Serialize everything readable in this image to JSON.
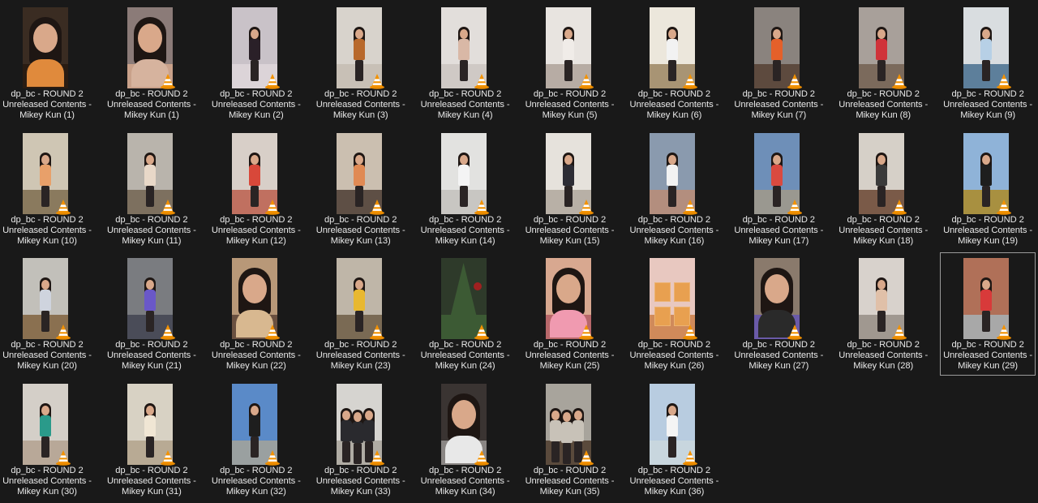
{
  "grid": {
    "columns": 10,
    "selected_item": 30,
    "items": [
      {
        "line1": "dp_bc - ROUND 2",
        "line2": "Unreleased Contents -",
        "line3": "Mikey Kun (1)",
        "vlc": false,
        "scene": "closeup",
        "bg": "#3a2c22",
        "floor": "#2a1c12",
        "top": "#e08a3c"
      },
      {
        "line1": "dp_bc - ROUND 2",
        "line2": "Unreleased Contents -",
        "line3": "Mikey Kun (1)",
        "vlc": true,
        "scene": "closeup",
        "bg": "#8b7b78",
        "floor": "#c9a18a",
        "top": "#d6b39e"
      },
      {
        "line1": "dp_bc - ROUND 2",
        "line2": "Unreleased Contents -",
        "line3": "Mikey Kun (2)",
        "vlc": true,
        "scene": "full",
        "bg": "#c9c2c8",
        "floor": "#dcd4d8",
        "top": "#2a2028"
      },
      {
        "line1": "dp_bc - ROUND 2",
        "line2": "Unreleased Contents -",
        "line3": "Mikey Kun (3)",
        "vlc": true,
        "scene": "full",
        "bg": "#d8d3cc",
        "floor": "#c8c0b6",
        "top": "#b8692c"
      },
      {
        "line1": "dp_bc - ROUND 2",
        "line2": "Unreleased Contents -",
        "line3": "Mikey Kun (4)",
        "vlc": true,
        "scene": "full",
        "bg": "#e2dedb",
        "floor": "#cfc9c5",
        "top": "#d9b8a6"
      },
      {
        "line1": "dp_bc - ROUND 2",
        "line2": "Unreleased Contents -",
        "line3": "Mikey Kun (5)",
        "vlc": true,
        "scene": "full",
        "bg": "#e8e4e0",
        "floor": "#b7aca4",
        "top": "#f0ece8"
      },
      {
        "line1": "dp_bc - ROUND 2",
        "line2": "Unreleased Contents -",
        "line3": "Mikey Kun (6)",
        "vlc": true,
        "scene": "full",
        "bg": "#ece7dc",
        "floor": "#a89474",
        "top": "#f2f2f2"
      },
      {
        "line1": "dp_bc - ROUND 2",
        "line2": "Unreleased Contents -",
        "line3": "Mikey Kun (7)",
        "vlc": true,
        "scene": "full",
        "bg": "#8a837e",
        "floor": "#5d4a3e",
        "top": "#e4602a"
      },
      {
        "line1": "dp_bc - ROUND 2",
        "line2": "Unreleased Contents -",
        "line3": "Mikey Kun (8)",
        "vlc": true,
        "scene": "full",
        "bg": "#a8a09a",
        "floor": "#7b6a5c",
        "top": "#d0333a"
      },
      {
        "line1": "dp_bc - ROUND 2",
        "line2": "Unreleased Contents -",
        "line3": "Mikey Kun (9)",
        "vlc": true,
        "scene": "full",
        "bg": "#d9dde0",
        "floor": "#5d7f9b",
        "top": "#b7d0e6"
      },
      {
        "line1": "dp_bc - ROUND 2",
        "line2": "Unreleased Contents -",
        "line3": "Mikey Kun (10)",
        "vlc": true,
        "scene": "full",
        "bg": "#cfc6b4",
        "floor": "#8a7a5e",
        "top": "#e8a06a"
      },
      {
        "line1": "dp_bc - ROUND 2",
        "line2": "Unreleased Contents -",
        "line3": "Mikey Kun (11)",
        "vlc": true,
        "scene": "full",
        "bg": "#b9b4ac",
        "floor": "#7d705f",
        "top": "#e8d8c8"
      },
      {
        "line1": "dp_bc - ROUND 2",
        "line2": "Unreleased Contents -",
        "line3": "Mikey Kun (12)",
        "vlc": true,
        "scene": "full",
        "bg": "#d8cfc8",
        "floor": "#c07060",
        "top": "#d8483a"
      },
      {
        "line1": "dp_bc - ROUND 2",
        "line2": "Unreleased Contents -",
        "line3": "Mikey Kun (13)",
        "vlc": true,
        "scene": "full",
        "bg": "#cbbfb0",
        "floor": "#5e4f45",
        "top": "#e08a54"
      },
      {
        "line1": "dp_bc - ROUND 2",
        "line2": "Unreleased Contents -",
        "line3": "Mikey Kun (14)",
        "vlc": true,
        "scene": "full",
        "bg": "#e2e2e0",
        "floor": "#c8c6c2",
        "top": "#f4f4f4"
      },
      {
        "line1": "dp_bc - ROUND 2",
        "line2": "Unreleased Contents -",
        "line3": "Mikey Kun (15)",
        "vlc": true,
        "scene": "full",
        "bg": "#e6e2dc",
        "floor": "#b8b0a6",
        "top": "#2c2c34"
      },
      {
        "line1": "dp_bc - ROUND 2",
        "line2": "Unreleased Contents -",
        "line3": "Mikey Kun (16)",
        "vlc": true,
        "scene": "full",
        "bg": "#8a9aae",
        "floor": "#b38e7e",
        "top": "#f2f2f2"
      },
      {
        "line1": "dp_bc - ROUND 2",
        "line2": "Unreleased Contents -",
        "line3": "Mikey Kun (17)",
        "vlc": true,
        "scene": "full",
        "bg": "#6e8fb8",
        "floor": "#9a9890",
        "top": "#d94a40"
      },
      {
        "line1": "dp_bc - ROUND 2",
        "line2": "Unreleased Contents -",
        "line3": "Mikey Kun (18)",
        "vlc": true,
        "scene": "full",
        "bg": "#d6d0c8",
        "floor": "#7a5a48",
        "top": "#3a3a3a"
      },
      {
        "line1": "dp_bc - ROUND 2",
        "line2": "Unreleased Contents -",
        "line3": "Mikey Kun (19)",
        "vlc": true,
        "scene": "full",
        "bg": "#8fb3d8",
        "floor": "#a89040",
        "top": "#1e1e1e"
      },
      {
        "line1": "dp_bc - ROUND 2",
        "line2": "Unreleased Contents -",
        "line3": "Mikey Kun (20)",
        "vlc": true,
        "scene": "full",
        "bg": "#c2c0ba",
        "floor": "#8a7050",
        "top": "#cfd4de"
      },
      {
        "line1": "dp_bc - ROUND 2",
        "line2": "Unreleased Contents -",
        "line3": "Mikey Kun (21)",
        "vlc": true,
        "scene": "full",
        "bg": "#7a7c80",
        "floor": "#4a4c58",
        "top": "#6a58c8"
      },
      {
        "line1": "dp_bc - ROUND 2",
        "line2": "Unreleased Contents -",
        "line3": "Mikey Kun (22)",
        "vlc": true,
        "scene": "closeup",
        "bg": "#b89878",
        "floor": "#6a5040",
        "top": "#d8b890"
      },
      {
        "line1": "dp_bc - ROUND 2",
        "line2": "Unreleased Contents -",
        "line3": "Mikey Kun (23)",
        "vlc": true,
        "scene": "full",
        "bg": "#bfb6a8",
        "floor": "#7a6a54",
        "top": "#e8b830"
      },
      {
        "line1": "dp_bc - ROUND 2",
        "line2": "Unreleased Contents -",
        "line3": "Mikey Kun (24)",
        "vlc": true,
        "scene": "tree",
        "bg": "#2e3a2a",
        "floor": "#3c5a34",
        "top": "#7a9a5a"
      },
      {
        "line1": "dp_bc - ROUND 2",
        "line2": "Unreleased Contents -",
        "line3": "Mikey Kun (25)",
        "vlc": true,
        "scene": "closeup",
        "bg": "#d8a890",
        "floor": "#b8686a",
        "top": "#f09ab0"
      },
      {
        "line1": "dp_bc - ROUND 2",
        "line2": "Unreleased Contents -",
        "line3": "Mikey Kun (26)",
        "vlc": true,
        "scene": "shelf",
        "bg": "#e8c8c0",
        "floor": "#d08a5a",
        "top": "#e8a050"
      },
      {
        "line1": "dp_bc - ROUND 2",
        "line2": "Unreleased Contents -",
        "line3": "Mikey Kun (27)",
        "vlc": true,
        "scene": "closeup",
        "bg": "#8a7a6c",
        "floor": "#6a5aa8",
        "top": "#2a2a2a"
      },
      {
        "line1": "dp_bc - ROUND 2",
        "line2": "Unreleased Contents -",
        "line3": "Mikey Kun (28)",
        "vlc": true,
        "scene": "full",
        "bg": "#d8d2cc",
        "floor": "#a09890",
        "top": "#e0c0a8"
      },
      {
        "line1": "dp_bc - ROUND 2",
        "line2": "Unreleased Contents -",
        "line3": "Mikey Kun (29)",
        "vlc": true,
        "scene": "full",
        "bg": "#b07058",
        "floor": "#a8a8a8",
        "top": "#d83a3a"
      },
      {
        "line1": "dp_bc - ROUND 2",
        "line2": "Unreleased Contents -",
        "line3": "Mikey Kun (30)",
        "vlc": true,
        "scene": "full",
        "bg": "#d4cfc8",
        "floor": "#b8a898",
        "top": "#2a9a8a"
      },
      {
        "line1": "dp_bc - ROUND 2",
        "line2": "Unreleased Contents -",
        "line3": "Mikey Kun (31)",
        "vlc": true,
        "scene": "full",
        "bg": "#d8d2c4",
        "floor": "#b8aa94",
        "top": "#f0e6d4"
      },
      {
        "line1": "dp_bc - ROUND 2",
        "line2": "Unreleased Contents -",
        "line3": "Mikey Kun (32)",
        "vlc": true,
        "scene": "full",
        "bg": "#5a8ac8",
        "floor": "#9aa0a0",
        "top": "#1e1e1e"
      },
      {
        "line1": "dp_bc - ROUND 2",
        "line2": "Unreleased Contents -",
        "line3": "Mikey Kun (33)",
        "vlc": true,
        "scene": "group",
        "bg": "#d6d4d0",
        "floor": "#b0aca4",
        "top": "#2a2a2e"
      },
      {
        "line1": "dp_bc - ROUND 2",
        "line2": "Unreleased Contents -",
        "line3": "Mikey Kun (34)",
        "vlc": true,
        "scene": "closeup",
        "bg": "#3a3432",
        "floor": "#8a8684",
        "top": "#e8e8e8"
      },
      {
        "line1": "dp_bc - ROUND 2",
        "line2": "Unreleased Contents -",
        "line3": "Mikey Kun (35)",
        "vlc": true,
        "scene": "group",
        "bg": "#a8a49c",
        "floor": "#5a4a3c",
        "top": "#c8c2b8"
      },
      {
        "line1": "dp_bc - ROUND 2",
        "line2": "Unreleased Contents -",
        "line3": "Mikey Kun (36)",
        "vlc": true,
        "scene": "full",
        "bg": "#b8cce0",
        "floor": "#c8d6de",
        "top": "#f4f4f4"
      }
    ]
  }
}
